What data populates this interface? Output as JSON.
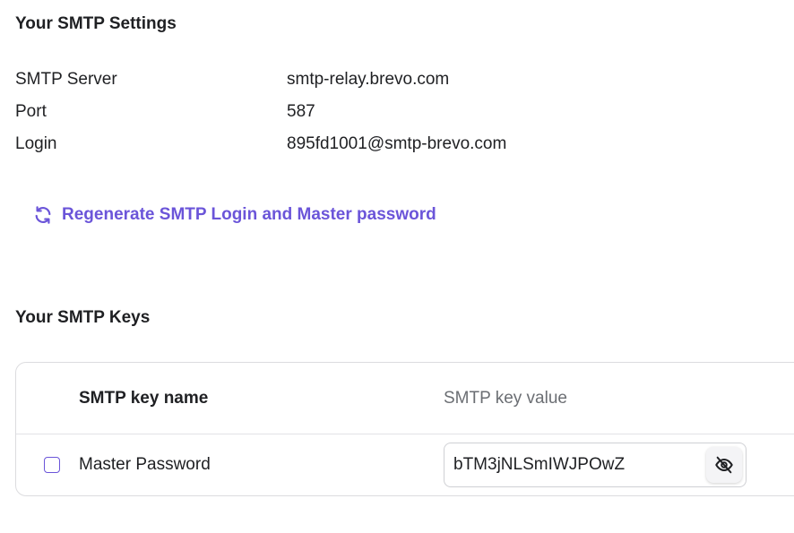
{
  "smtp_settings": {
    "title": "Your SMTP Settings",
    "rows": [
      {
        "label": "SMTP Server",
        "value": "smtp-relay.brevo.com"
      },
      {
        "label": "Port",
        "value": "587"
      },
      {
        "label": "Login",
        "value": "895fd1001@smtp-brevo.com"
      }
    ],
    "regenerate_label": "Regenerate SMTP Login and Master password"
  },
  "smtp_keys": {
    "title": "Your SMTP Keys",
    "columns": {
      "name": "SMTP key name",
      "value": "SMTP key value"
    },
    "rows": [
      {
        "name": "Master Password",
        "value": "bTM3jNLSmIWJPOwZ",
        "checked": false
      }
    ]
  },
  "icons": {
    "regenerate": "refresh-icon",
    "visibility": "eye-off-icon"
  },
  "colors": {
    "accent": "#6b55d9",
    "text": "#1f2023",
    "muted_header": "#6b6e73",
    "border": "#dcdcdf"
  }
}
